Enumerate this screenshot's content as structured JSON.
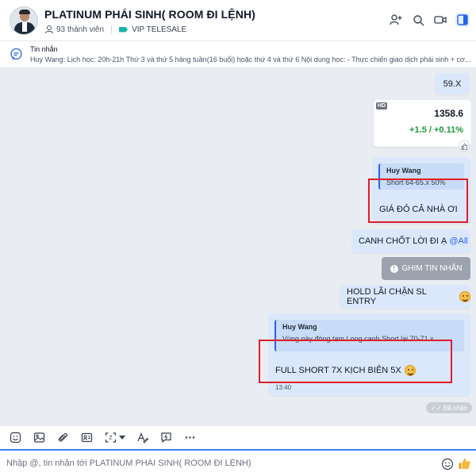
{
  "header": {
    "group_name": "PLATINUM PHÁI SINH( ROOM ĐI LỆNH)",
    "members": "93 thành viên",
    "label": "VIP TELESALE",
    "label_color": "#15b3a7"
  },
  "pinned": {
    "title": "Tin nhắn",
    "text": "Huy Wang: Lịch học:  20h-21h Thứ 3 và thứ 5 hàng tuần(16 buổi) hoặc thứ 4 và thứ 6 Nội dung học:  - Thực chiến giao dịch phái sinh + cơ..."
  },
  "messages": {
    "m1": "59.X",
    "card": {
      "badge": "HD",
      "price": "1358.6",
      "change": "+1.5 / +0.11%"
    },
    "m3": {
      "quote_name": "Huy Wang",
      "quote_text": "Short 64-65.x 50%",
      "text": "GIÁ ĐỎ CẢ NHÀ ƠI"
    },
    "m4": {
      "text": "CANH CHỐT LỜI ĐI Ạ",
      "mention": "@All"
    },
    "notice": {
      "icon": "!",
      "text": "GHIM TIN NHẮN"
    },
    "m5": "HOLD LÃI CHẶN SL ENTRY",
    "m6": {
      "quote_name": "Huy Wang",
      "quote_text": "Vùng này đóng tạm Long canh Short lại 70-71.x",
      "text": "FULL SHORT 7X KỊCH BIÊN 5X",
      "time": "13:40"
    },
    "status": "✓✓ Đã nhận"
  },
  "input": {
    "placeholder": "Nhập @, tin nhắn tới PLATINUM PHÁI SINH( ROOM ĐI LỆNH)"
  },
  "colors": {
    "accent": "#2563eb",
    "highlight": "#e11d2a",
    "positive": "#1e9a3c"
  }
}
